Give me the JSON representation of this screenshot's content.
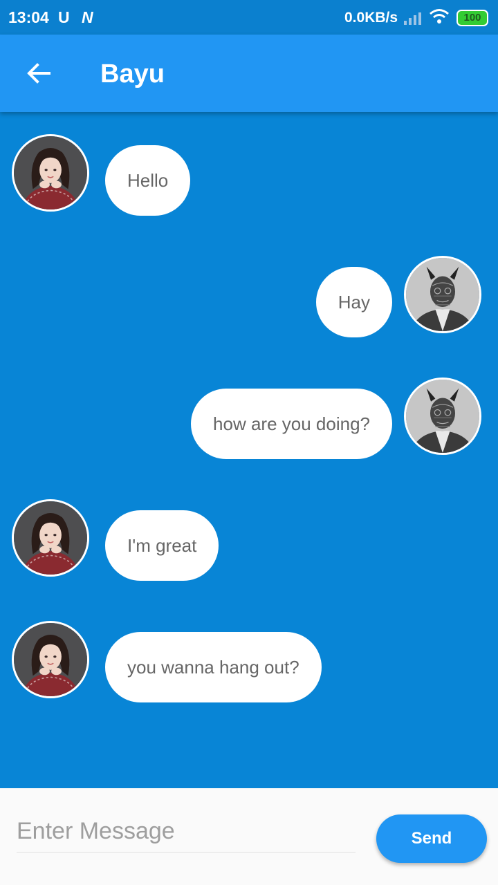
{
  "status_bar": {
    "time": "13:04",
    "carrier_glyph_1": "U",
    "carrier_glyph_2": "N",
    "network_speed": "0.0KB/s",
    "battery_level": "100",
    "icons": [
      "signal-icon",
      "wifi-icon",
      "battery-icon"
    ]
  },
  "app_bar": {
    "back_icon": "arrow-left-icon",
    "title": "Bayu",
    "background_color": "#2196f3"
  },
  "chat": {
    "background_color": "#0885d6",
    "messages": [
      {
        "sender": "contact",
        "text": "Hello"
      },
      {
        "sender": "me",
        "text": "Hay"
      },
      {
        "sender": "me",
        "text": "how are you doing?"
      },
      {
        "sender": "contact",
        "text": "I'm great"
      },
      {
        "sender": "contact",
        "text": "you wanna hang out?"
      }
    ]
  },
  "composer": {
    "placeholder": "Enter Message",
    "value": "",
    "send_label": "Send"
  }
}
